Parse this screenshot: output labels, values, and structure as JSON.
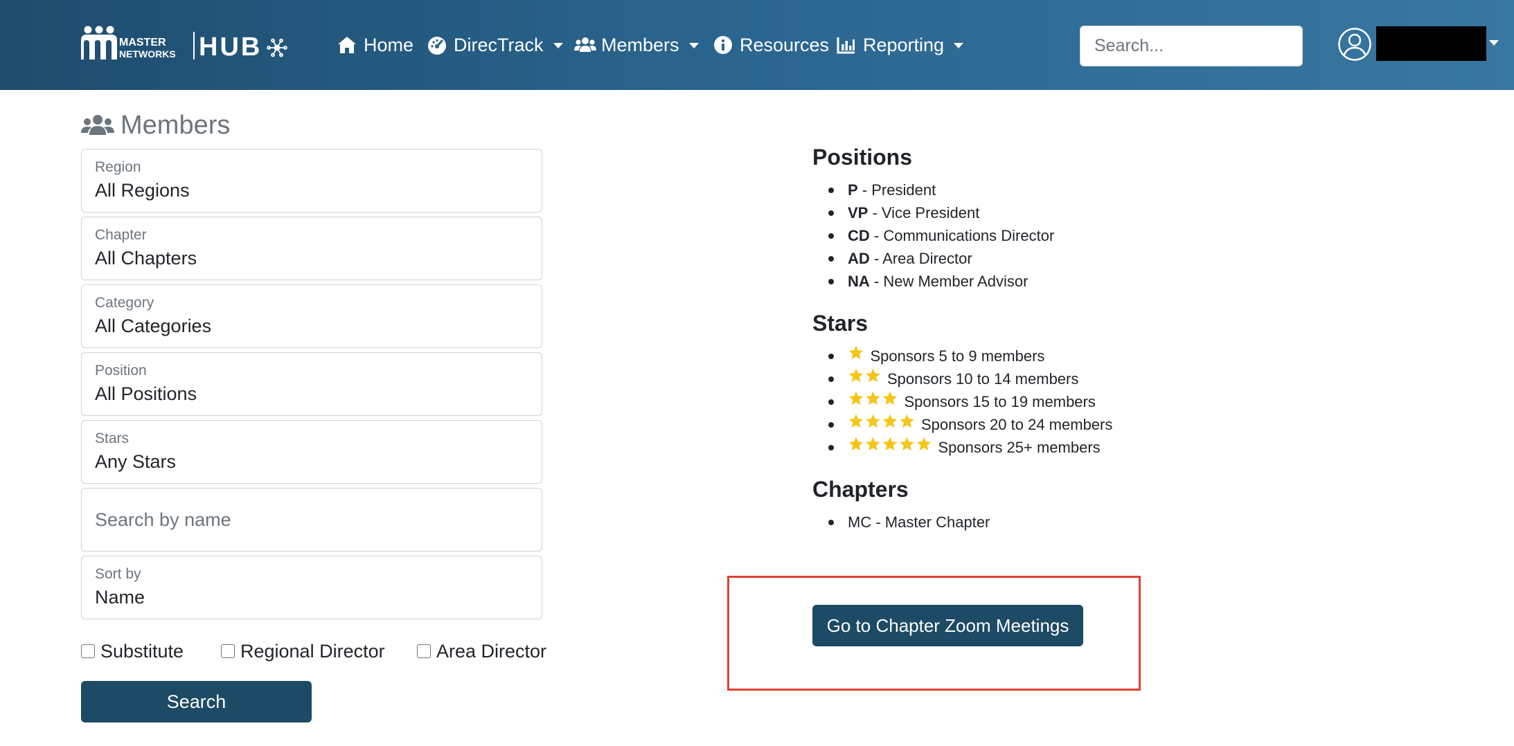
{
  "brand": {
    "logo_text_line1": "MASTER",
    "logo_text_line2": "NETWORKS",
    "logo_hub": "HUB"
  },
  "nav": {
    "home": "Home",
    "directrack": "DirecTrack",
    "members": "Members",
    "resources": "Resources",
    "reporting": "Reporting",
    "search_placeholder": "Search..."
  },
  "page": {
    "title": "Members"
  },
  "filters": {
    "region": {
      "label": "Region",
      "value": "All Regions"
    },
    "chapter": {
      "label": "Chapter",
      "value": "All Chapters"
    },
    "category": {
      "label": "Category",
      "value": "All Categories"
    },
    "position": {
      "label": "Position",
      "value": "All Positions"
    },
    "stars": {
      "label": "Stars",
      "value": "Any Stars"
    },
    "name_search": {
      "placeholder": "Search by name"
    },
    "sort": {
      "label": "Sort by",
      "value": "Name"
    },
    "checkboxes": {
      "substitute": "Substitute",
      "regional_director": "Regional Director",
      "area_director": "Area Director"
    },
    "search_button": "Search"
  },
  "legend": {
    "positions_heading": "Positions",
    "positions": [
      {
        "abbr": "P",
        "desc": " - President"
      },
      {
        "abbr": "VP",
        "desc": " - Vice President"
      },
      {
        "abbr": "CD",
        "desc": " - Communications Director"
      },
      {
        "abbr": "AD",
        "desc": " - Area Director"
      },
      {
        "abbr": "NA",
        "desc": " - New Member Advisor"
      }
    ],
    "stars_heading": "Stars",
    "stars": [
      {
        "count": 1,
        "text": "Sponsors 5 to 9 members"
      },
      {
        "count": 2,
        "text": "Sponsors 10 to 14 members"
      },
      {
        "count": 3,
        "text": "Sponsors 15 to 19 members"
      },
      {
        "count": 4,
        "text": "Sponsors 20 to 24 members"
      },
      {
        "count": 5,
        "text": "Sponsors 25+ members"
      }
    ],
    "star_color": "#f5c518",
    "chapters_heading": "Chapters",
    "chapters": [
      {
        "text": "MC - Master Chapter"
      }
    ]
  },
  "zoom_button": "Go to Chapter Zoom Meetings",
  "colors": {
    "nav_gradient_start": "#1e4c6d",
    "nav_gradient_end": "#3877a1",
    "button_primary": "#1d4a64",
    "highlight": "#e0412e"
  }
}
